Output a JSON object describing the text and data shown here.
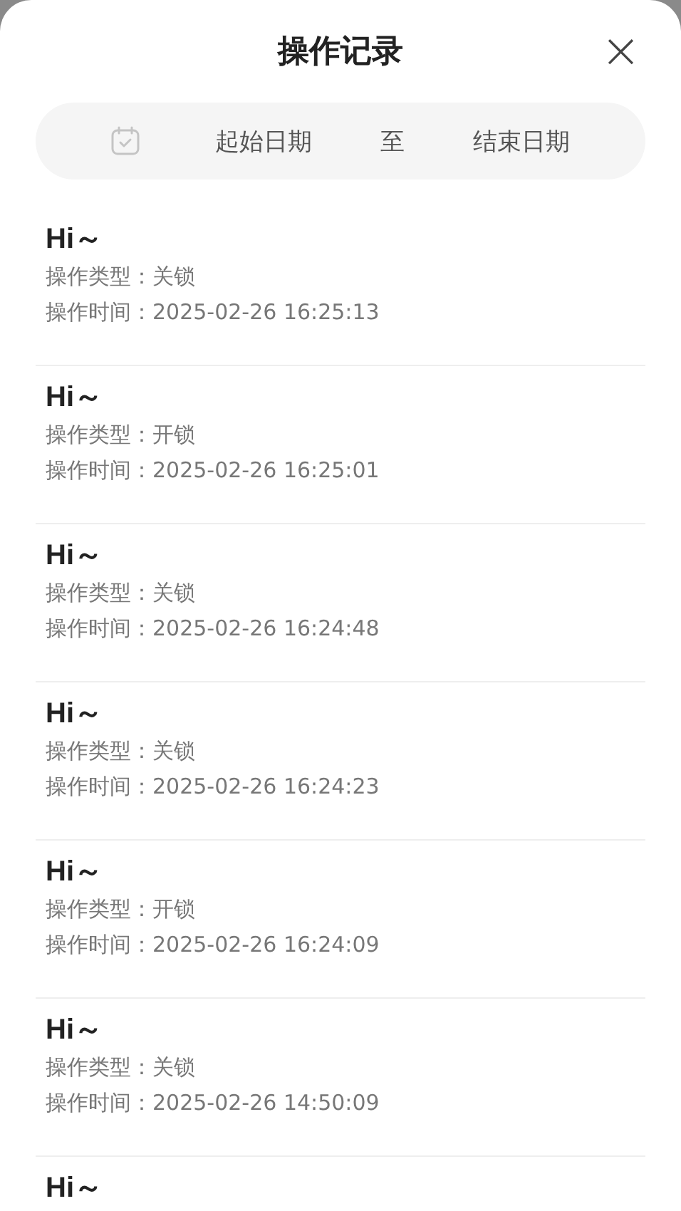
{
  "title": "操作记录",
  "close": "×",
  "filter": {
    "start_placeholder": "起始日期",
    "separator": "至",
    "end_placeholder": "结束日期"
  },
  "records": [
    {
      "name": "Hi～",
      "type_label": "操作类型：",
      "type": "关锁",
      "time_label": "操作时间：",
      "time": "2025-02-26 16:25:13"
    },
    {
      "name": "Hi～",
      "type_label": "操作类型：",
      "type": "开锁",
      "time_label": "操作时间：",
      "time": "2025-02-26 16:25:01"
    },
    {
      "name": "Hi～",
      "type_label": "操作类型：",
      "type": "关锁",
      "time_label": "操作时间：",
      "time": "2025-02-26 16:24:48"
    },
    {
      "name": "Hi～",
      "type_label": "操作类型：",
      "type": "关锁",
      "time_label": "操作时间：",
      "time": "2025-02-26 16:24:23"
    },
    {
      "name": "Hi～",
      "type_label": "操作类型：",
      "type": "开锁",
      "time_label": "操作时间：",
      "time": "2025-02-26 16:24:09"
    },
    {
      "name": "Hi～",
      "type_label": "操作类型：",
      "type": "关锁",
      "time_label": "操作时间：",
      "time": "2025-02-26 14:50:09"
    },
    {
      "name": "Hi～"
    }
  ]
}
